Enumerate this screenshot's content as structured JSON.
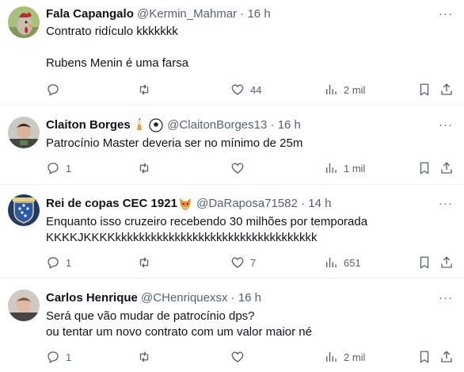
{
  "tweets": [
    {
      "name": "Fala Capangalo",
      "handle": "@Kermin_Mahmar",
      "dot": "·",
      "time": "16 h",
      "text": "Contrato ridículo kkkkkkk\n\nRubens Menin é uma farsa",
      "replies": "",
      "retweets": "",
      "likes": "44",
      "views": "2 mil"
    },
    {
      "name": "Claiton Borges",
      "handle": "@ClaitonBorges13",
      "dot": "·",
      "time": "16 h",
      "text": "Patrocínio Master deveria ser no mínimo de 25m",
      "replies": "1",
      "retweets": "",
      "likes": "",
      "views": "1 mil"
    },
    {
      "name": "Rei de copas CEC 1921",
      "handle": "@DaRaposa71582",
      "dot": "·",
      "time": "14 h",
      "text": "Enquanto isso cruzeiro recebendo 30 milhões por temporada\nKKKKJKKKKkkkkkkkkkkkkkkkkkkkkkkkkkkkkkkkkkk",
      "replies": "1",
      "retweets": "",
      "likes": "7",
      "views": "651"
    },
    {
      "name": "Carlos Henrique",
      "handle": "@CHenriquexsx",
      "dot": "·",
      "time": "16 h",
      "text": "Será que vão mudar de patrocínio dps?\nou tentar um novo contrato com um valor maior né",
      "replies": "1",
      "retweets": "",
      "likes": "",
      "views": "2 mil"
    }
  ],
  "more_label": "···",
  "colors": {
    "text": "#0f1419",
    "secondary": "#536471",
    "divider": "#eff3f4"
  },
  "icons": [
    "reply-icon",
    "retweet-icon",
    "like-icon",
    "views-icon",
    "bookmark-icon",
    "share-icon"
  ]
}
